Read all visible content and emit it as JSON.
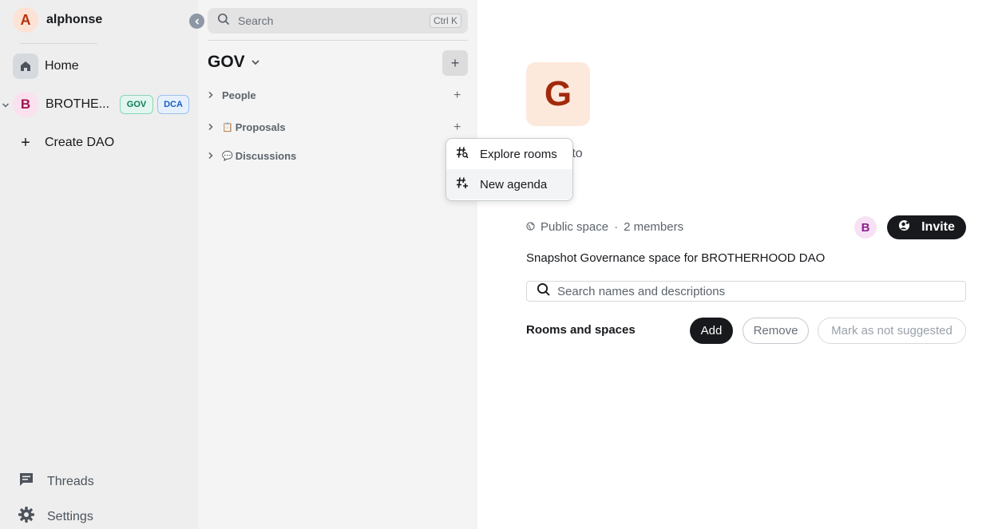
{
  "user": {
    "avatar_letter": "A",
    "name": "alphonse"
  },
  "spaces_nav": {
    "home_label": "Home",
    "space": {
      "avatar_letter": "B",
      "name": "BROTHE...",
      "tags": [
        "GOV",
        "DCA"
      ]
    },
    "create_label": "Create DAO"
  },
  "bottom_nav": {
    "threads_label": "Threads",
    "settings_label": "Settings"
  },
  "room_list": {
    "search_placeholder": "Search",
    "search_shortcut": "Ctrl K",
    "space_title": "GOV",
    "sections": [
      {
        "label": "People",
        "emoji": ""
      },
      {
        "label": "Proposals",
        "emoji": "📋"
      },
      {
        "label": "Discussions",
        "emoji": "💬"
      }
    ]
  },
  "context_menu": {
    "items": [
      "Explore rooms",
      "New agenda"
    ]
  },
  "space_home": {
    "avatar_letter": "G",
    "welcome_partial": "e to",
    "visibility": "Public space",
    "members": "2 members",
    "member_avatar_letter": "B",
    "invite_label": "Invite",
    "description": "Snapshot Governance space for BROTHERHOOD DAO",
    "filter_placeholder": "Search names and descriptions",
    "rooms_heading": "Rooms and spaces",
    "add_label": "Add",
    "remove_label": "Remove",
    "mark_label": "Mark as not suggested"
  },
  "colors": {
    "accent_dark": "#17191c",
    "panel_bg": "#eeeeee",
    "roomlist_bg": "#f4f4f4"
  }
}
